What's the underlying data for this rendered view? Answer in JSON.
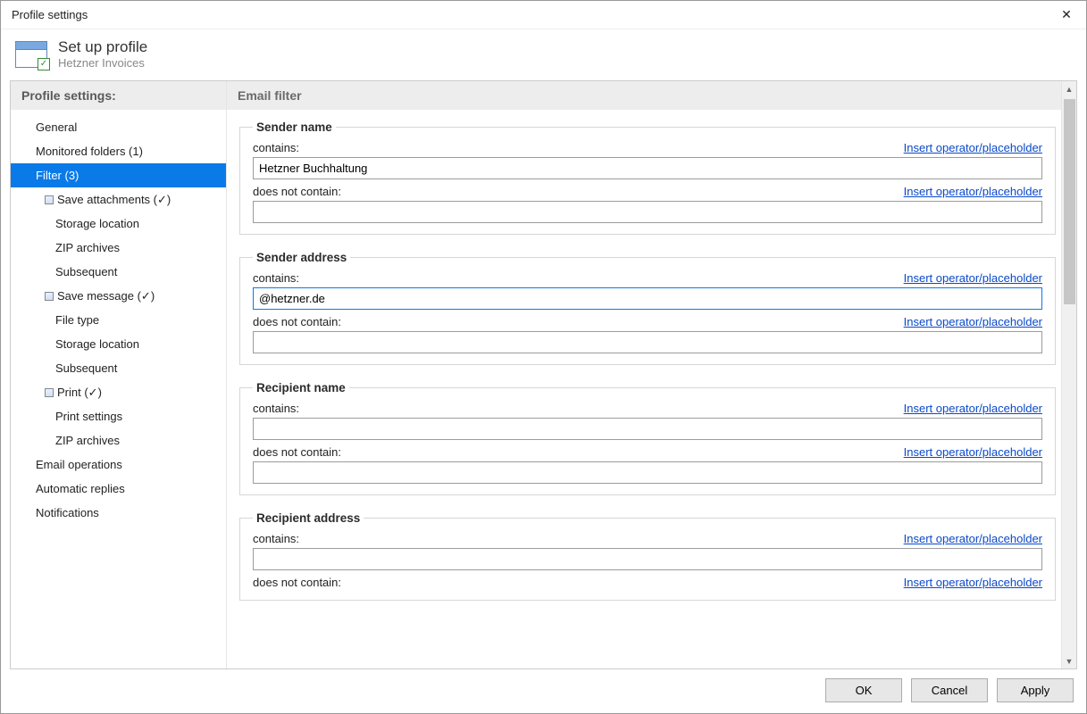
{
  "window": {
    "title": "Profile settings"
  },
  "header": {
    "title": "Set up profile",
    "subtitle": "Hetzner Invoices"
  },
  "sidebar": {
    "heading": "Profile settings:",
    "items": {
      "general": "General",
      "monitored": "Monitored folders (1)",
      "filter": "Filter (3)",
      "save_attachments": "Save attachments (✓)",
      "storage_location": "Storage location",
      "zip_archives": "ZIP archives",
      "subsequent": "Subsequent",
      "save_message": "Save message (✓)",
      "file_type": "File type",
      "storage_location2": "Storage location",
      "subsequent2": "Subsequent",
      "print": "Print  (✓)",
      "print_settings": "Print settings",
      "zip_archives2": "ZIP archives",
      "email_ops": "Email operations",
      "auto_replies": "Automatic replies",
      "notifications": "Notifications"
    }
  },
  "main": {
    "heading": "Email filter",
    "labels": {
      "contains": "contains:",
      "not_contain": "does not contain:",
      "insert_link": "Insert operator/placeholder"
    },
    "groups": {
      "sender_name": {
        "legend": "Sender name",
        "contains": "Hetzner Buchhaltung",
        "not_contain": ""
      },
      "sender_address": {
        "legend": "Sender address",
        "contains": "@hetzner.de",
        "not_contain": ""
      },
      "recipient_name": {
        "legend": "Recipient name",
        "contains": "",
        "not_contain": ""
      },
      "recipient_address": {
        "legend": "Recipient address",
        "contains": "",
        "not_contain": ""
      }
    }
  },
  "footer": {
    "ok": "OK",
    "cancel": "Cancel",
    "apply": "Apply"
  }
}
